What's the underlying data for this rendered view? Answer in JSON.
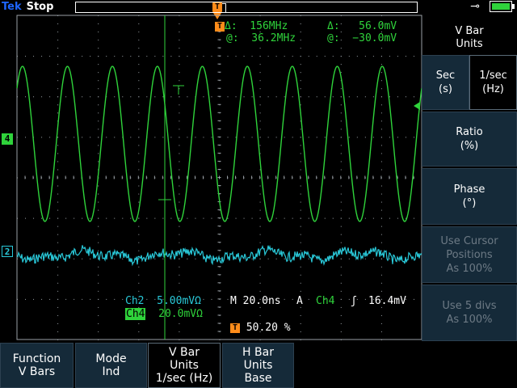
{
  "status": {
    "brand": "Tek",
    "state": "Stop"
  },
  "cursor_readout": {
    "t_delta": "Δ:  156MHz",
    "t_at": "@:  36.2MHz",
    "v_delta": "Δ:   56.0mV",
    "v_at": "@:  −30.0mV"
  },
  "bottom_readout": {
    "ch2": "Ch2",
    "ch2_scale": "5.00mVΩ",
    "ch4": "Ch4",
    "ch4_scale": "20.0mVΩ",
    "timebase": "M 20.0ns",
    "trigger_mode": "A",
    "trigger_source": "Ch4",
    "trigger_slope": "ʃ",
    "trigger_level": "16.4mV",
    "trigger_pos": "50.20 %"
  },
  "markers": {
    "ch4": "4",
    "ch2": "2",
    "trigger": "T"
  },
  "right_menu": {
    "title_line1": "V Bar",
    "title_line2": "Units",
    "sec_line1": "Sec",
    "sec_line2": "(s)",
    "hz_line1": "1/sec",
    "hz_line2": "(Hz)",
    "ratio_line1": "Ratio",
    "ratio_line2": "(%)",
    "phase_line1": "Phase",
    "phase_line2": "(°)",
    "cursor_line1": "Use Cursor",
    "cursor_line2": "Positions",
    "cursor_line3": "As 100%",
    "divs_line1": "Use 5 divs",
    "divs_line2": "As 100%"
  },
  "bottom_menu": [
    {
      "line1": "Function",
      "line2": "V Bars",
      "line3": ""
    },
    {
      "line1": "Mode",
      "line2": "Ind",
      "line3": ""
    },
    {
      "line1": "V Bar",
      "line2": "Units",
      "line3": "1/sec (Hz)"
    },
    {
      "line1": "H Bar",
      "line2": "Units",
      "line3": "Base"
    }
  ],
  "colors": {
    "ch4": "#2fd33b",
    "ch2": "#29c8d8",
    "trigger": "#ff8c1a",
    "grid": "#9aa0a6",
    "menu_bg": "#152a39"
  },
  "waveforms": {
    "ch4": {
      "shape": "sine",
      "cycles_on_screen": 9
    },
    "ch2": {
      "shape": "noise"
    }
  }
}
